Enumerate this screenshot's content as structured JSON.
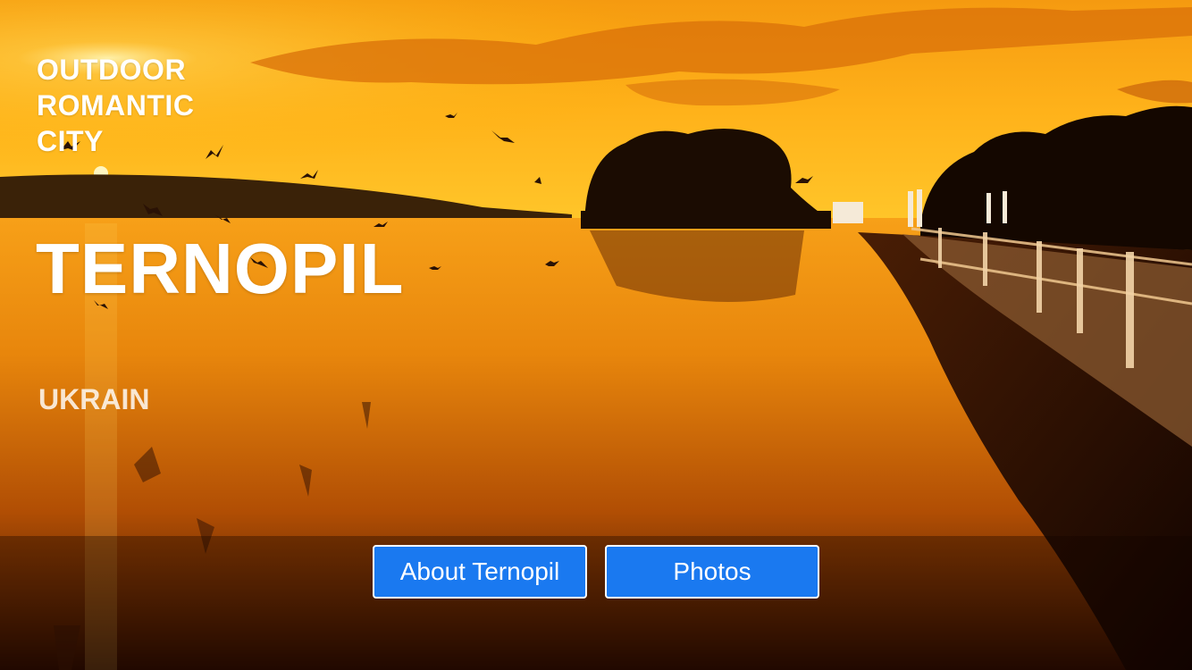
{
  "hero": {
    "tagline": [
      "OUTDOOR",
      "ROMANTIC",
      "CITY"
    ],
    "city": "TERNOPIL",
    "country": "UKRAIN"
  },
  "buttons": {
    "about": "About Ternopil",
    "photos": "Photos"
  },
  "colors": {
    "button_fill": "#1a79f0",
    "button_border": "#ffffff",
    "text": "#ffffff"
  }
}
